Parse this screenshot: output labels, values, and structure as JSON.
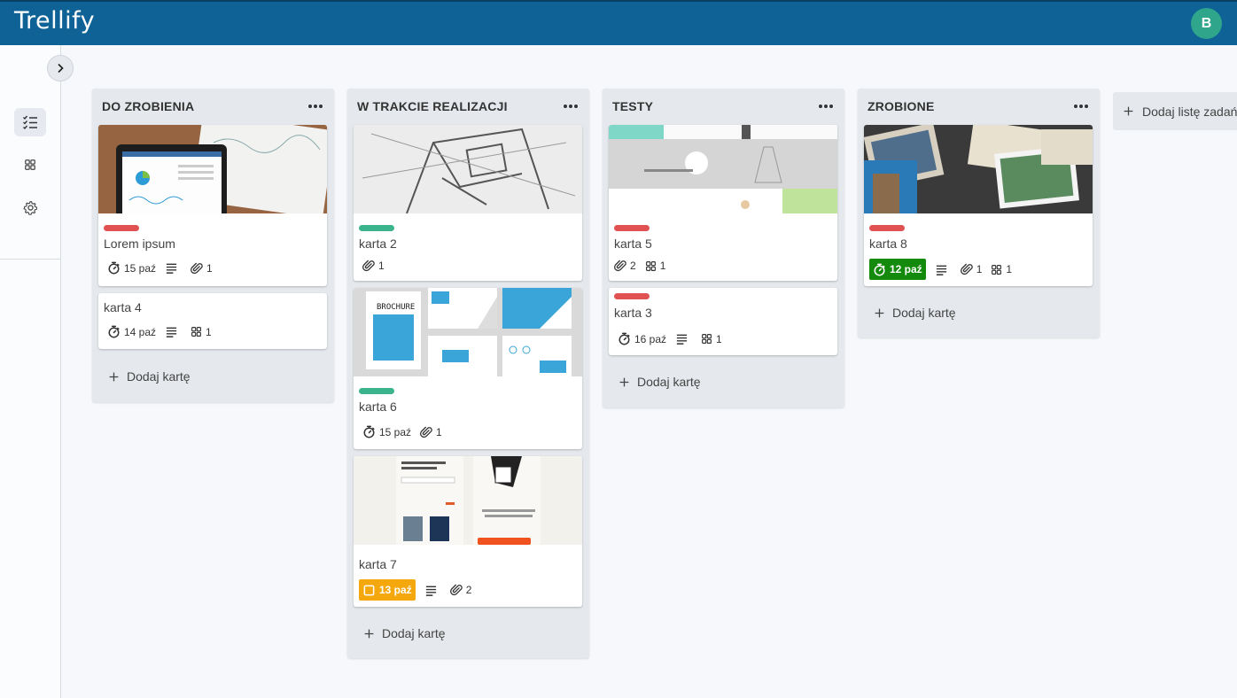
{
  "app": {
    "name": "Trellify",
    "user_initial": "B",
    "brand_color": "#0e6296",
    "avatar_color": "#2fa58c"
  },
  "sidebar": {
    "items": [
      {
        "icon": "checklist-icon",
        "active": true
      },
      {
        "icon": "grid-icon",
        "active": false
      },
      {
        "icon": "gear-icon",
        "active": false
      }
    ]
  },
  "board": {
    "add_list_label": "Dodaj listę zadań",
    "add_card_label": "Dodaj kartę",
    "lists": [
      {
        "title": "DO ZROBIENIA",
        "cards": [
          {
            "title": "Lorem ipsum",
            "label_color": "#e05252",
            "cover": "tablet-charts",
            "due": "15 paź",
            "description": true,
            "attachments": "1"
          },
          {
            "title": "karta 4",
            "due": "14 paź",
            "description": true,
            "checklist": "1"
          }
        ]
      },
      {
        "title": "W TRAKCIE REALIZACJI",
        "cards": [
          {
            "title": "karta 2",
            "label_color": "#3bb38d",
            "cover": "floor-plan",
            "attachments": "1"
          },
          {
            "title": "karta 6",
            "label_color": "#3bb38d",
            "cover": "brochure",
            "due": "15 paź",
            "attachments": "1"
          },
          {
            "title": "karta 7",
            "cover": "app-mockup",
            "due": "13 paź",
            "due_style": "warning",
            "description": true,
            "attachments": "2"
          }
        ]
      },
      {
        "title": "TESTY",
        "cards": [
          {
            "title": "karta 5",
            "label_color": "#e05252",
            "cover": "website-mockup",
            "attachments": "2",
            "checklist": "1"
          },
          {
            "title": "karta 3",
            "label_color": "#e05252",
            "due": "16 paź",
            "description": true,
            "checklist": "1"
          }
        ]
      },
      {
        "title": "ZROBIONE",
        "cards": [
          {
            "title": "karta 8",
            "label_color": "#e05252",
            "cover": "photo-prints",
            "due": "12 paź",
            "due_style": "complete",
            "description": true,
            "attachments": "1",
            "checklist": "1"
          }
        ]
      }
    ]
  }
}
